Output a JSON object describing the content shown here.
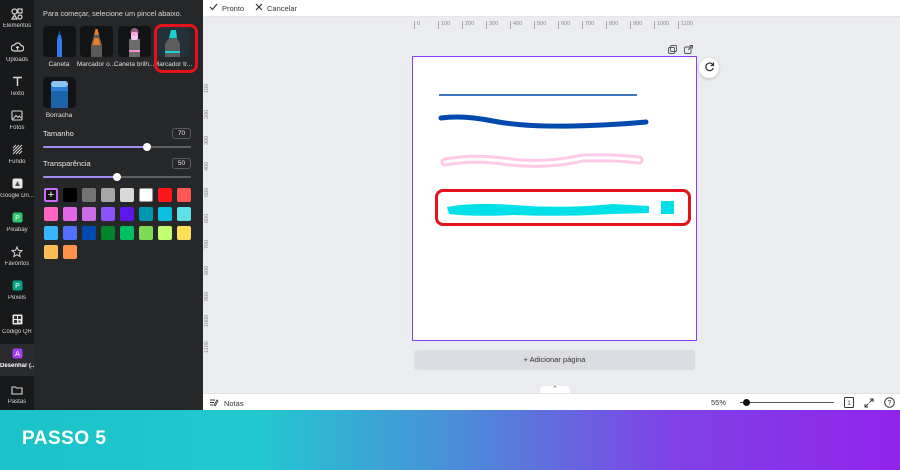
{
  "sidebar": {
    "items": [
      {
        "label": "Elementos",
        "icon": "shapes-icon"
      },
      {
        "label": "Uploads",
        "icon": "cloud-upload-icon"
      },
      {
        "label": "Texto",
        "icon": "text-icon"
      },
      {
        "label": "Fotos",
        "icon": "image-icon"
      },
      {
        "label": "Fundo",
        "icon": "pattern-icon"
      },
      {
        "label": "Google Dri...",
        "icon": "google-drive-icon"
      },
      {
        "label": "Pixabay",
        "icon": "pixabay-icon"
      },
      {
        "label": "Favoritos",
        "icon": "star-icon"
      },
      {
        "label": "Pexels",
        "icon": "pexels-icon"
      },
      {
        "label": "Código QR",
        "icon": "qr-code-icon"
      },
      {
        "label": "Desenhar (...",
        "icon": "draw-icon"
      },
      {
        "label": "Pastas",
        "icon": "folder-icon"
      }
    ]
  },
  "draw_panel": {
    "hint": "Para começar, selecione um pincel abaixo.",
    "tools": [
      {
        "label": "Caneta",
        "icon": "pen-icon",
        "color": "#2f7bf2"
      },
      {
        "label": "Marcador o...",
        "icon": "marker-icon",
        "color": "#f07b22"
      },
      {
        "label": "Caneta brilh...",
        "icon": "glow-pen-icon",
        "color": "#f48fd0"
      },
      {
        "label": "Marcador tr...",
        "icon": "highlighter-icon",
        "color": "#16d1d1"
      },
      {
        "label": "Borracha",
        "icon": "eraser-icon",
        "color": "#2a7fd4"
      }
    ],
    "size_label": "Tamanho",
    "size_value": "70",
    "size_level": 0.7,
    "transparency_label": "Transparência",
    "transparency_value": "50",
    "transparency_level": 0.5,
    "colors": [
      "#000000",
      "#737373",
      "#a6a6a6",
      "#d9d9d9",
      "#ffffff",
      "#ff1616",
      "#ff5757",
      "#ff66c4",
      "#e367e6",
      "#cb6ce6",
      "#8c52ff",
      "#5e17eb",
      "#0097b2",
      "#0cc0df",
      "#5ce1e6",
      "#38b6ff",
      "#5271ff",
      "#004aad",
      "#00852c",
      "#00bf63",
      "#7ed957",
      "#c1ff72",
      "#ffde59",
      "#ffbd59"
    ],
    "extra_colors": [
      "#ff914d"
    ]
  },
  "toolbar": {
    "done_label": "Pronto",
    "cancel_label": "Cancelar"
  },
  "ruler": {
    "h_ticks": [
      "0",
      "100",
      "200",
      "300",
      "400",
      "500",
      "600",
      "700",
      "800",
      "900",
      "1000",
      "1100"
    ],
    "v_ticks": [
      "100",
      "200",
      "300",
      "400",
      "500",
      "600",
      "700",
      "800",
      "900",
      "1000",
      "1100"
    ]
  },
  "canvas": {
    "strokes": [
      {
        "type": "pen",
        "color": "#004aad"
      },
      {
        "type": "marker",
        "color": "#004aad"
      },
      {
        "type": "glow",
        "color": "#ff66c4"
      },
      {
        "type": "highlighter",
        "color": "#00e0e8"
      }
    ],
    "add_page_label": "+ Adicionar página"
  },
  "bottombar": {
    "notes_label": "Notas",
    "zoom_label": "55%",
    "zoom_level": 0.55
  },
  "banner": {
    "text": "PASSO 5"
  }
}
